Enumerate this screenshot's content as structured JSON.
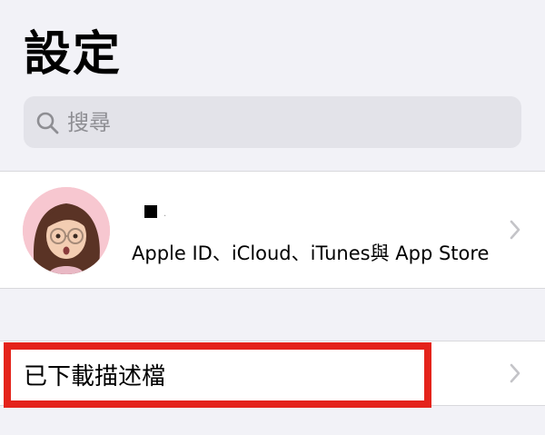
{
  "header": {
    "title": "設定"
  },
  "search": {
    "placeholder": "搜尋",
    "icon": "search-icon"
  },
  "profile": {
    "name_dot": ".",
    "subtitle": "Apple ID、iCloud、iTunes與 App Store",
    "avatar": "memoji-avatar"
  },
  "settings": {
    "profiles_label": "已下載描述檔"
  },
  "colors": {
    "background": "#f2f2f7",
    "highlight": "#e4231b",
    "search_bg": "#e3e3e9"
  }
}
